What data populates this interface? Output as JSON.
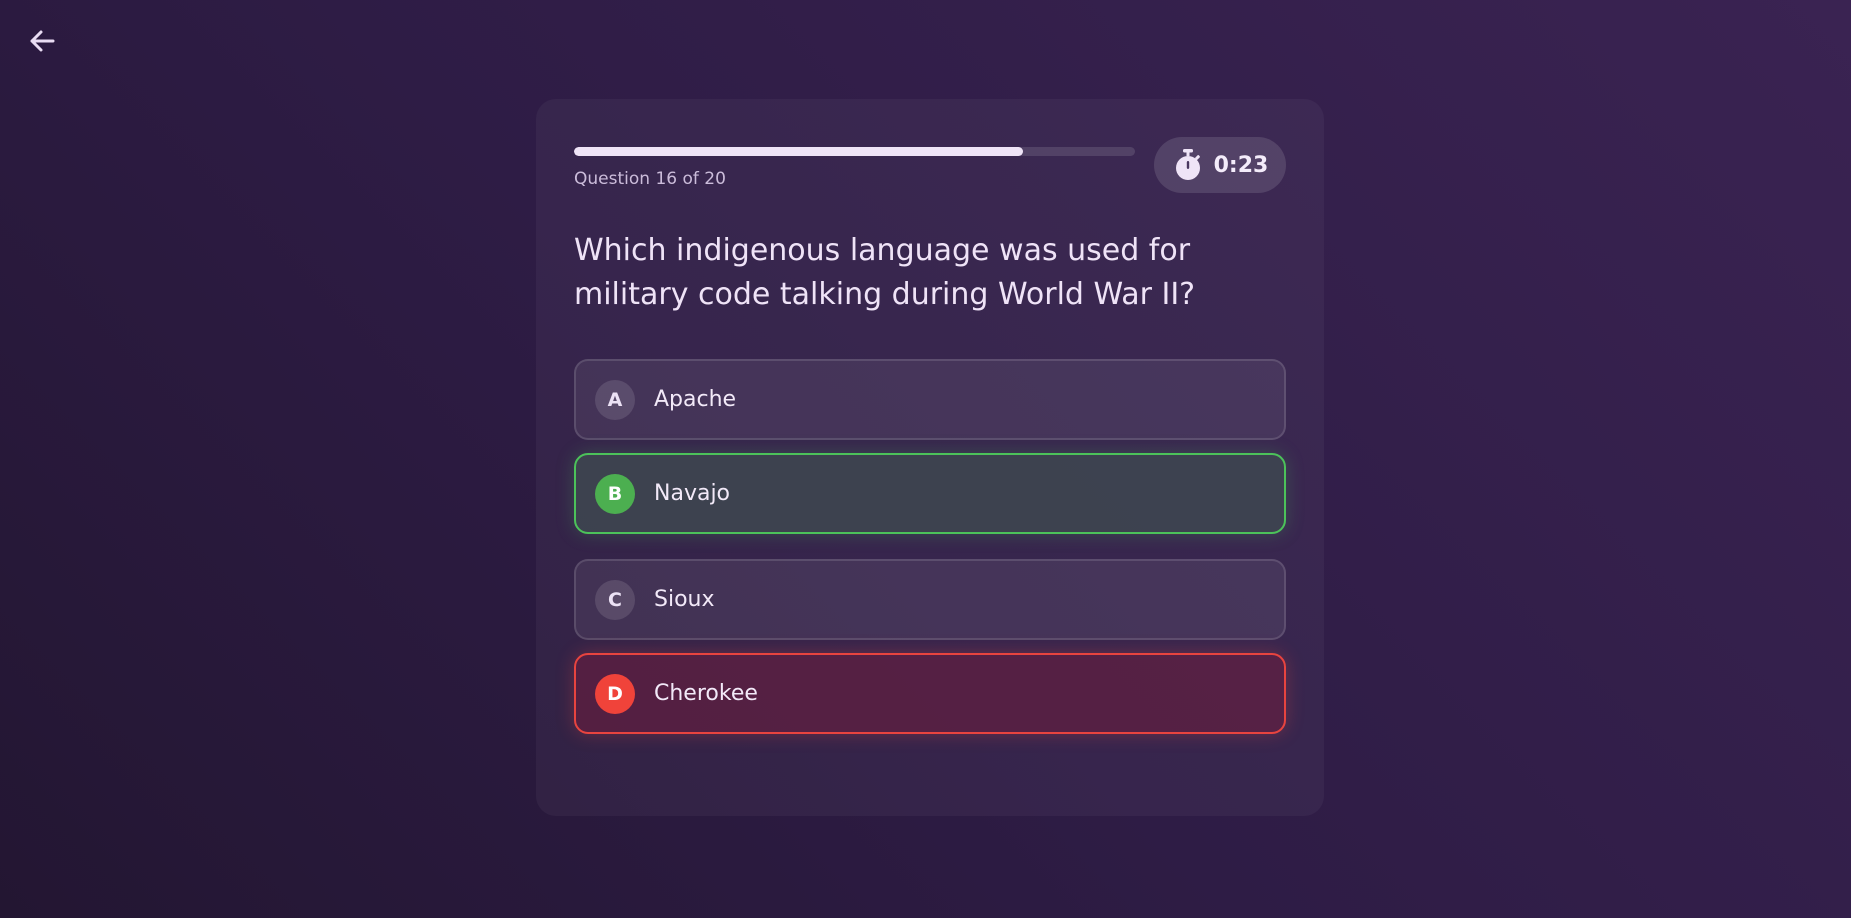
{
  "nav": {
    "back_icon": "arrow-left-icon"
  },
  "progress": {
    "label": "Question 16 of 20",
    "current": 16,
    "total": 20,
    "fill_fraction": 0.8
  },
  "timer": {
    "icon": "stopwatch-icon",
    "value": "0:23"
  },
  "question": {
    "text": "Which indigenous language was used for military code talking during World War II?"
  },
  "answers": [
    {
      "letter": "A",
      "label": "Apache",
      "state": "default"
    },
    {
      "letter": "B",
      "label": "Navajo",
      "state": "correct"
    },
    {
      "letter": "C",
      "label": "Sioux",
      "state": "default"
    },
    {
      "letter": "D",
      "label": "Cherokee",
      "state": "wrong"
    }
  ],
  "colors": {
    "correct": "#4caf50",
    "wrong": "#f0433a",
    "progress_fill": "#efe4f7"
  }
}
